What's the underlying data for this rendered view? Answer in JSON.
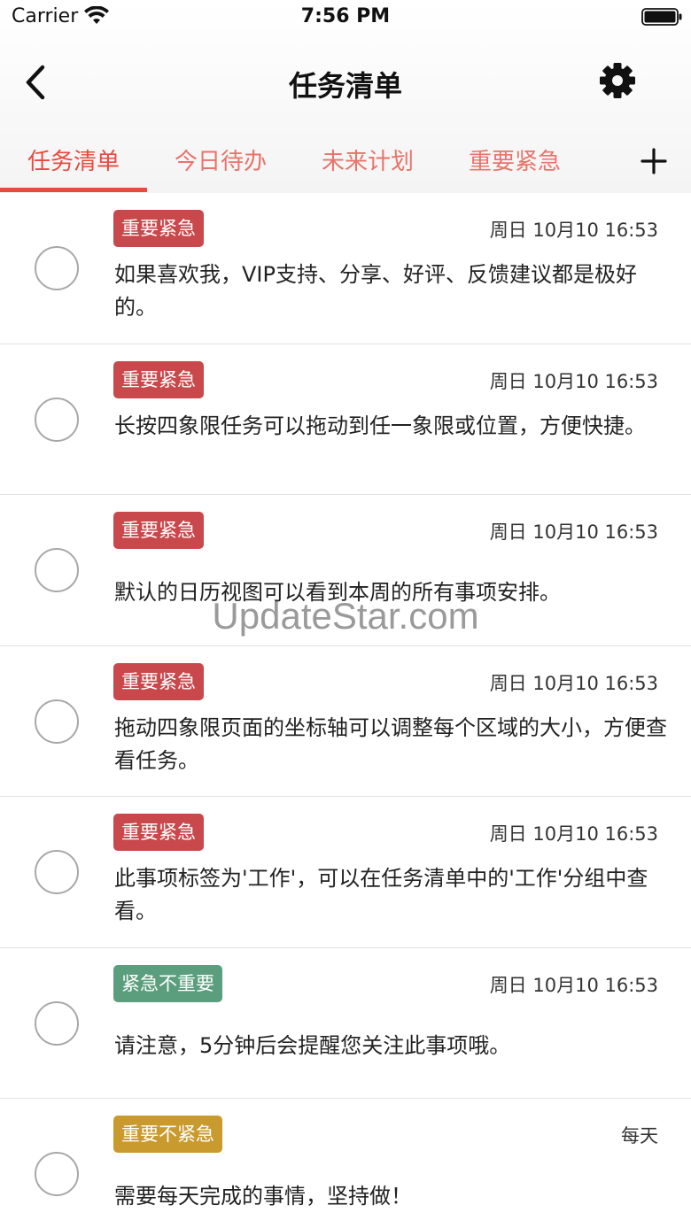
{
  "status_bar": {
    "carrier": "Carrier",
    "time": "7:56 PM"
  },
  "nav": {
    "title": "任务清单",
    "back_icon": "chevron-left-icon",
    "settings_icon": "gear-icon"
  },
  "tabs": [
    {
      "label": "任务清单",
      "active": true
    },
    {
      "label": "今日待办",
      "active": false
    },
    {
      "label": "未来计划",
      "active": false
    },
    {
      "label": "重要紧急",
      "active": false
    }
  ],
  "colors": {
    "accent": "#e84a3f",
    "tab_inactive": "#e8746b",
    "badge_important_urgent": "#c9484c",
    "badge_urgent_not_important": "#5b9e7d",
    "badge_important_not_urgent": "#c99a2e"
  },
  "tasks": [
    {
      "tag": "重要紧急",
      "tag_color": "#c9484c",
      "time": "周日 10月10 16:53",
      "content": "如果喜欢我，VIP支持、分享、好评、反馈建议都是极好的。"
    },
    {
      "tag": "重要紧急",
      "tag_color": "#c9484c",
      "time": "周日 10月10 16:53",
      "content": "长按四象限任务可以拖动到任一象限或位置，方便快捷。"
    },
    {
      "tag": "重要紧急",
      "tag_color": "#c9484c",
      "time": "周日 10月10 16:53",
      "content": "默认的日历视图可以看到本周的所有事项安排。"
    },
    {
      "tag": "重要紧急",
      "tag_color": "#c9484c",
      "time": "周日 10月10 16:53",
      "content": "拖动四象限页面的坐标轴可以调整每个区域的大小，方便查看任务。"
    },
    {
      "tag": "重要紧急",
      "tag_color": "#c9484c",
      "time": "周日 10月10 16:53",
      "content": "此事项标签为'工作'，可以在任务清单中的'工作'分组中查看。"
    },
    {
      "tag": "紧急不重要",
      "tag_color": "#5b9e7d",
      "time": "周日 10月10 16:53",
      "content": "请注意，5分钟后会提醒您关注此事项哦。"
    },
    {
      "tag": "重要不紧急",
      "tag_color": "#c99a2e",
      "time": "每天",
      "content": "需要每天完成的事情，坚持做！"
    }
  ],
  "watermark": "UpdateStar.com"
}
